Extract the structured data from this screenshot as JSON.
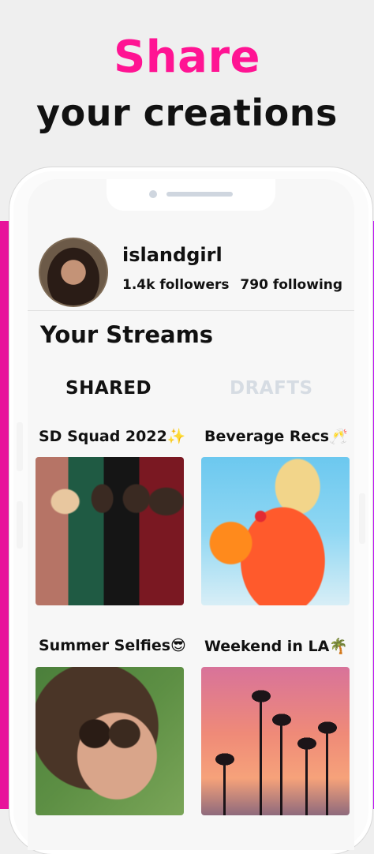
{
  "headline": {
    "line1": "Share",
    "line2": "your creations"
  },
  "profile": {
    "username": "islandgirl",
    "followers": "1.4k followers",
    "following": "790 following"
  },
  "streams": {
    "title": "Your Streams",
    "tabs": [
      {
        "label": "SHARED",
        "active": true
      },
      {
        "label": "DRAFTS",
        "active": false
      }
    ],
    "cards": [
      {
        "title": "SD Squad 2022✨"
      },
      {
        "title": "Beverage Recs🥂"
      },
      {
        "title": "Summer Selfies😎"
      },
      {
        "title": "Weekend in LA🌴"
      }
    ]
  },
  "colors": {
    "headline_pink": "#ff1493",
    "band_gradient": [
      "#e8139a",
      "#bf13f5"
    ],
    "tab_active": "#111111",
    "tab_inactive": "#d6dce3"
  }
}
